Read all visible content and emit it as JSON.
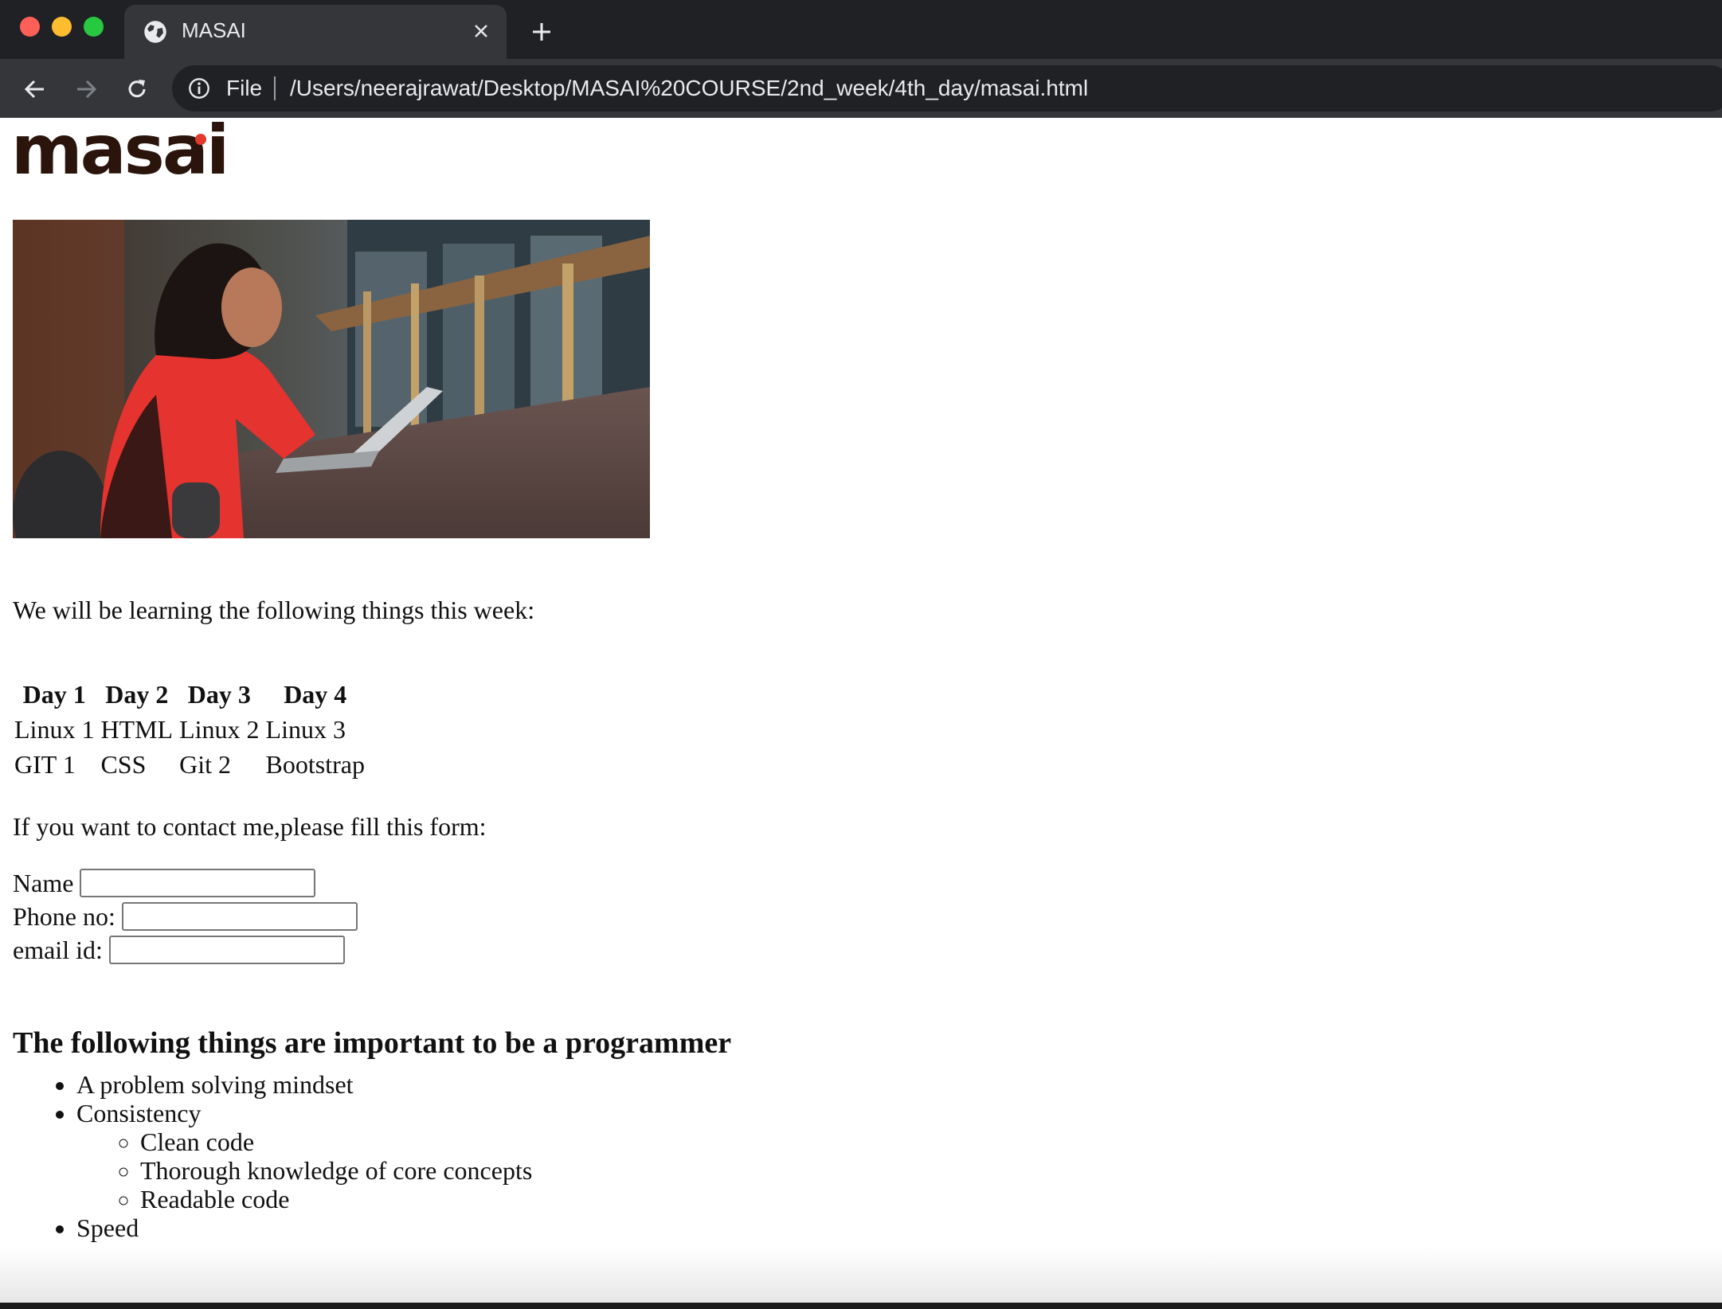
{
  "browser": {
    "tab_title": "MASAI",
    "omnibox_scheme": "File",
    "omnibox_url": "/Users/neerajrawat/Desktop/MASAI%20COURSE/2nd_week/4th_day/masai.html",
    "icons": [
      "globe-icon",
      "close-icon",
      "plus-icon",
      "back-arrow-icon",
      "forward-arrow-icon",
      "reload-icon",
      "info-icon"
    ]
  },
  "page": {
    "logo_text": "masai",
    "logo_dot_color": "#e23a2d",
    "hero_image": "photo of a woman in a red sweater typing on a laptop at a long wooden desk",
    "intro_text": "We will be learning the following things this week:",
    "schedule": {
      "headers": [
        "Day 1",
        "Day 2",
        "Day 3",
        "Day 4"
      ],
      "rows": [
        [
          "Linux 1",
          "HTML",
          "Linux 2",
          "Linux 3"
        ],
        [
          "GIT 1",
          "CSS",
          "Git 2",
          "Bootstrap"
        ]
      ]
    },
    "contact_text": "If you want to contact me,please fill this form:",
    "form": {
      "name_label": "Name",
      "name_value": "",
      "phone_label": "Phone no:",
      "phone_value": "",
      "email_label": "email id:",
      "email_value": ""
    },
    "section_heading": "The following things are important to be a programmer",
    "skills": {
      "item1": "A problem solving mindset",
      "item2": "Consistency",
      "sub": [
        "Clean code",
        "Thorough knowledge of core concepts",
        "Readable code"
      ],
      "item3": "Speed"
    }
  }
}
